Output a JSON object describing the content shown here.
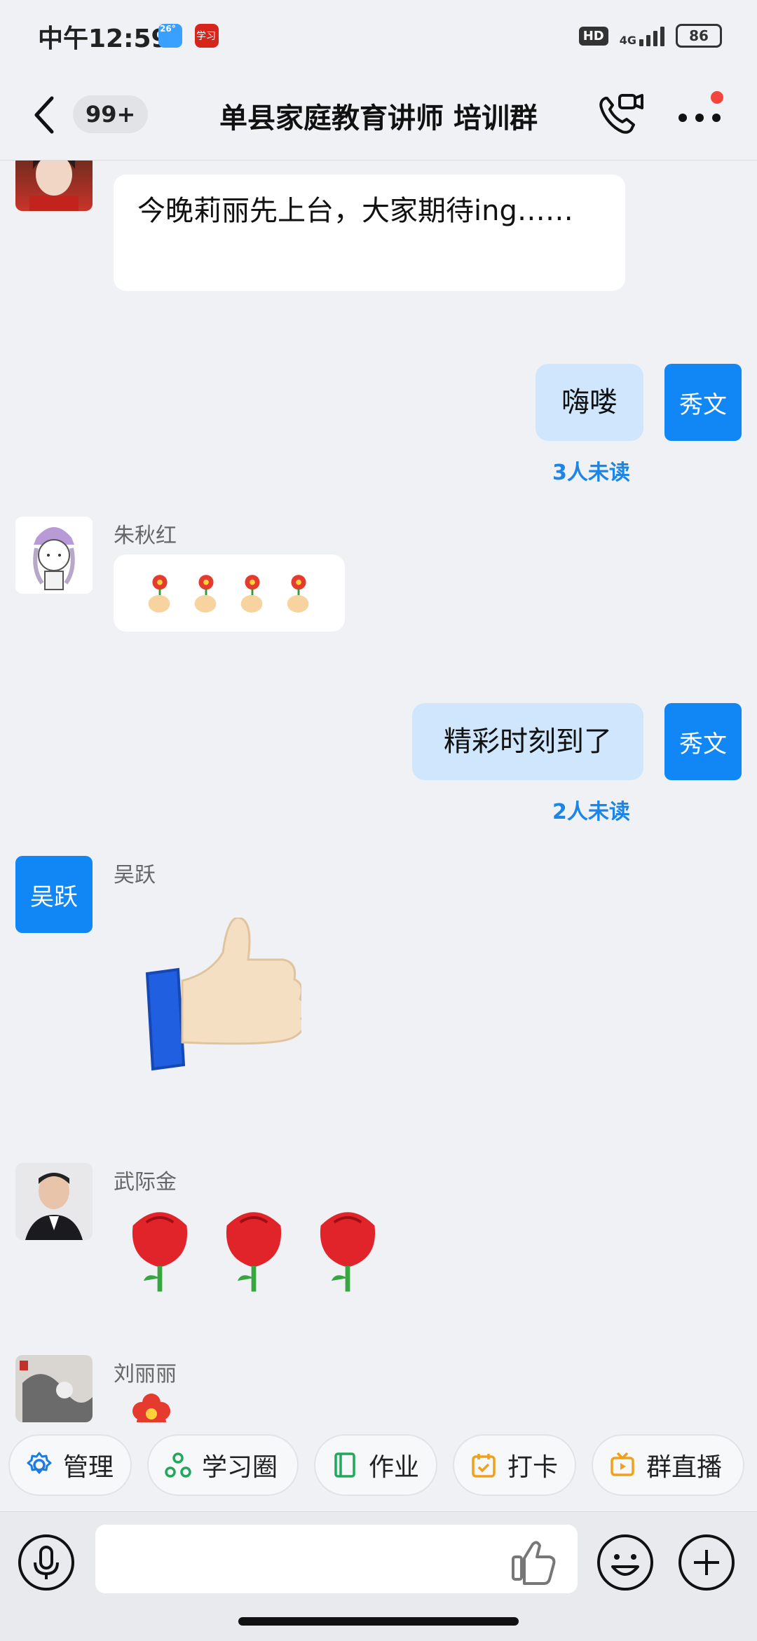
{
  "status_bar": {
    "time": "中午12:59",
    "weather_icon_text": "26°",
    "app_icon_text": "学习",
    "hd": "HD",
    "network": "4G",
    "battery": "86"
  },
  "header": {
    "unread_badge": "99+",
    "title": "单县家庭教育讲师 培训群"
  },
  "messages": [
    {
      "type": "in",
      "text": "今晚莉丽先上台，大家期待ing……"
    },
    {
      "type": "out",
      "avatar": "秀文",
      "text": "嗨喽",
      "unread": "3人未读"
    },
    {
      "type": "in",
      "sender": "朱秋红",
      "sticker": "flower-hands"
    },
    {
      "type": "out",
      "avatar": "秀文",
      "text": "精彩时刻到了",
      "unread": "2人未读"
    },
    {
      "type": "in",
      "sender": "吴跃",
      "avatar": "吴跃",
      "sticker": "thumbs-up"
    },
    {
      "type": "in",
      "sender": "武际金",
      "sticker": "three-roses"
    },
    {
      "type": "in",
      "sender": "刘丽丽",
      "sticker": "flower"
    }
  ],
  "quick_actions": [
    {
      "label": "管理",
      "icon": "gear-icon"
    },
    {
      "label": "学习圈",
      "icon": "circle-nodes-icon"
    },
    {
      "label": "作业",
      "icon": "book-icon"
    },
    {
      "label": "打卡",
      "icon": "calendar-check-icon"
    },
    {
      "label": "群直播",
      "icon": "tv-icon"
    }
  ],
  "input": {
    "placeholder": ""
  },
  "colors": {
    "accent": "#1186f5",
    "unread": "#1b86e8",
    "outgoing_bubble": "#cfe6fd",
    "background": "#f0f1f4"
  }
}
